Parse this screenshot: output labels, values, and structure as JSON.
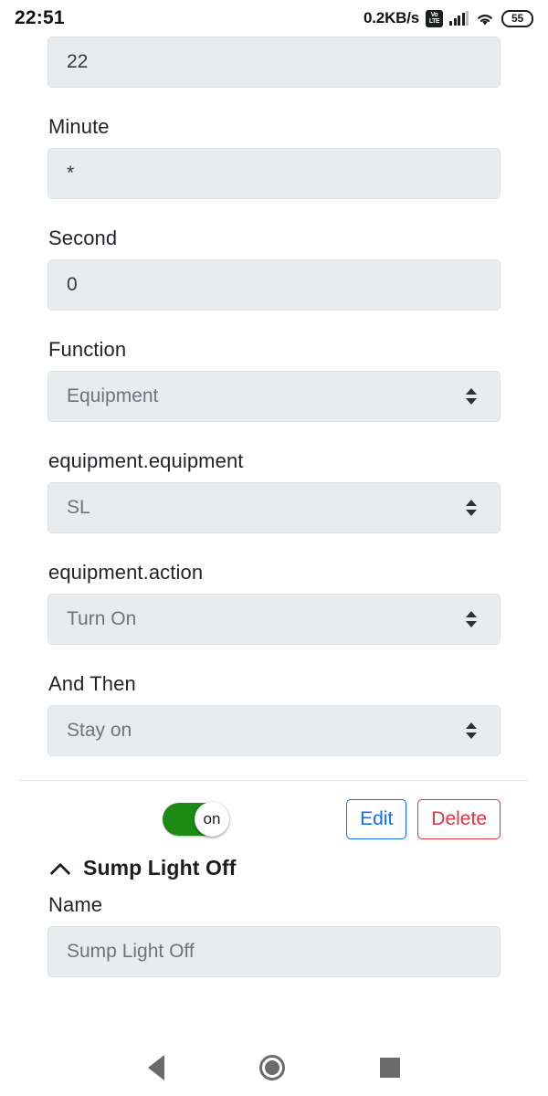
{
  "status_bar": {
    "time": "22:51",
    "network_speed": "0.2KB/s",
    "volte_top": "Vo",
    "volte_bottom": "LTE",
    "battery_level": "55",
    "icons": [
      "volte-icon",
      "signal-bars-icon",
      "wifi-icon",
      "battery-icon"
    ]
  },
  "form": {
    "hour_field": {
      "value": "22"
    },
    "minute_field": {
      "label": "Minute",
      "value": "*"
    },
    "second_field": {
      "label": "Second",
      "value": "0"
    },
    "function_field": {
      "label": "Function",
      "value": "Equipment"
    },
    "equipment_field": {
      "label": "equipment.equipment",
      "value": "SL"
    },
    "action_field": {
      "label": "equipment.action",
      "value": "Turn On"
    },
    "and_then_field": {
      "label": "And Then",
      "value": "Stay on"
    }
  },
  "actions": {
    "toggle_state": "on",
    "edit_label": "Edit",
    "delete_label": "Delete"
  },
  "next_section": {
    "title": "Sump Light Off",
    "name_label": "Name",
    "name_value": "Sump Light Off"
  },
  "nav_bar": {
    "back": "back-icon",
    "home": "home-icon",
    "recents": "recents-icon"
  },
  "colors": {
    "accent_blue": "#0d6efd",
    "danger_red": "#dc3545",
    "toggle_green": "#1d8a16",
    "control_bg": "#e9ecef"
  }
}
